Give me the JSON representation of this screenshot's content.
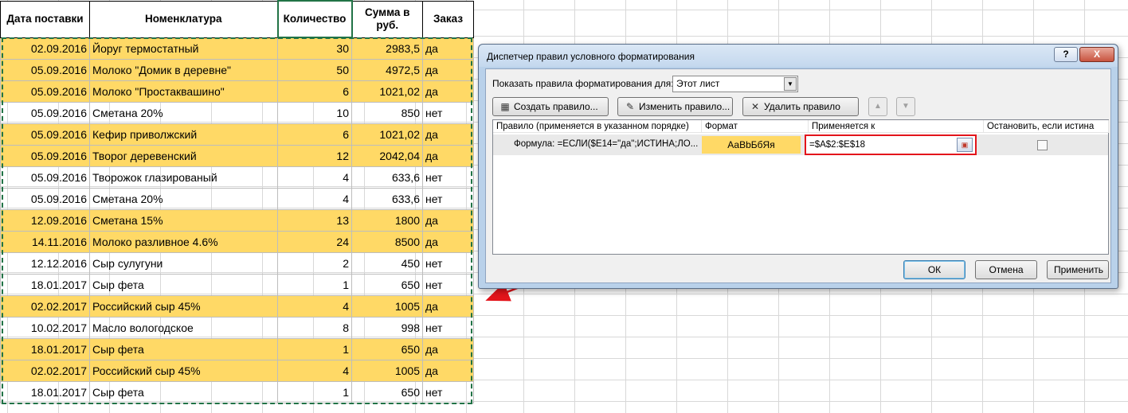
{
  "sheet": {
    "headers": {
      "date": "Дата поставки",
      "name": "Номенклатура",
      "qty": "Количество",
      "sum": "Сумма в руб.",
      "order": "Заказ"
    },
    "rows": [
      {
        "date": "02.09.2016",
        "name": "Йоруг термостатный",
        "qty": "30",
        "sum": "2983,5",
        "order": "да"
      },
      {
        "date": "05.09.2016",
        "name": "Молоко \"Домик в деревне\"",
        "qty": "50",
        "sum": "4972,5",
        "order": "да"
      },
      {
        "date": "05.09.2016",
        "name": "Молоко \"Простаквашино\"",
        "qty": "6",
        "sum": "1021,02",
        "order": "да"
      },
      {
        "date": "05.09.2016",
        "name": "Сметана 20%",
        "qty": "10",
        "sum": "850",
        "order": "нет"
      },
      {
        "date": "05.09.2016",
        "name": "Кефир приволжский",
        "qty": "6",
        "sum": "1021,02",
        "order": "да"
      },
      {
        "date": "05.09.2016",
        "name": "Творог деревенский",
        "qty": "12",
        "sum": "2042,04",
        "order": "да"
      },
      {
        "date": "05.09.2016",
        "name": "Творожок глазированый",
        "qty": "4",
        "sum": "633,6",
        "order": "нет"
      },
      {
        "date": "05.09.2016",
        "name": "Сметана 20%",
        "qty": "4",
        "sum": "633,6",
        "order": "нет"
      },
      {
        "date": "12.09.2016",
        "name": "Сметана 15%",
        "qty": "13",
        "sum": "1800",
        "order": "да"
      },
      {
        "date": "14.11.2016",
        "name": "Молоко разливное 4.6%",
        "qty": "24",
        "sum": "8500",
        "order": "да"
      },
      {
        "date": "12.12.2016",
        "name": "Сыр сулугуни",
        "qty": "2",
        "sum": "450",
        "order": "нет"
      },
      {
        "date": "18.01.2017",
        "name": "Сыр фета",
        "qty": "1",
        "sum": "650",
        "order": "нет"
      },
      {
        "date": "02.02.2017",
        "name": "Российский сыр 45%",
        "qty": "4",
        "sum": "1005",
        "order": "да"
      },
      {
        "date": "10.02.2017",
        "name": "Масло вологодское",
        "qty": "8",
        "sum": "998",
        "order": "нет"
      },
      {
        "date": "18.01.2017",
        "name": "Сыр фета",
        "qty": "1",
        "sum": "650",
        "order": "да"
      },
      {
        "date": "02.02.2017",
        "name": "Российский сыр 45%",
        "qty": "4",
        "sum": "1005",
        "order": "да"
      },
      {
        "date": "18.01.2017",
        "name": "Сыр фета",
        "qty": "1",
        "sum": "650",
        "order": "нет"
      }
    ],
    "highlight_color": "#ffd966"
  },
  "dialog": {
    "title": "Диспетчер правил условного форматирования",
    "help_label": "?",
    "close_label": "X",
    "show_rules_label": "Показать правила форматирования для:",
    "show_rules_value": "Этот лист",
    "buttons": {
      "create": "Создать правило...",
      "edit": "Изменить правило...",
      "delete": "Удалить правило",
      "up": "▲",
      "down": "▼",
      "ok": "ОК",
      "cancel": "Отмена",
      "apply": "Применить"
    },
    "columns": {
      "rule": "Правило (применяется в указанном порядке)",
      "format": "Формат",
      "applies_to": "Применяется к",
      "stop": "Остановить, если истина"
    },
    "rule": {
      "text": "Формула: =ЕСЛИ($E14=\"да\";ИСТИНА;ЛО...",
      "format_preview": "АаВbБбЯя",
      "applies_to": "=$A$2:$E$18",
      "stop_if_true": false
    },
    "highlight_box_color": "#e3141b"
  },
  "icons": {
    "create": "new-rule-icon",
    "edit": "edit-rule-icon",
    "delete": "delete-x-icon",
    "collapse": "range-collapse-icon"
  }
}
